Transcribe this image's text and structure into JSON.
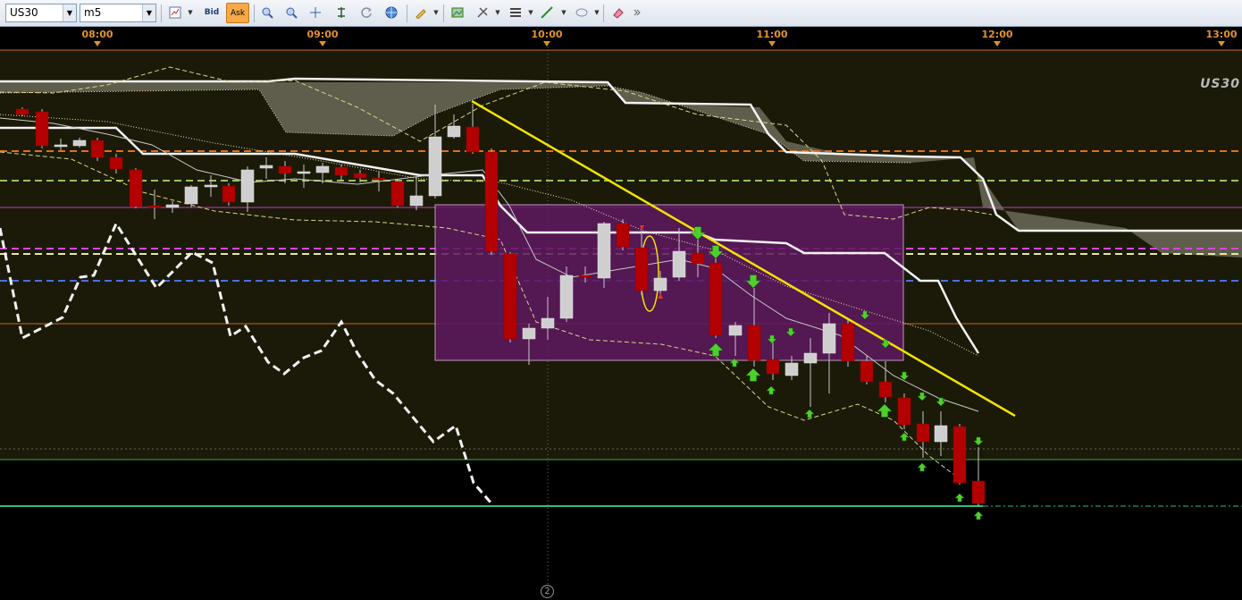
{
  "toolbar": {
    "symbol_value": "US30",
    "timeframe_value": "m5",
    "bid_label": "Bid",
    "ask_label": "Ask",
    "icons": [
      "chart-type-icon",
      "zoom-in-icon",
      "zoom-out-icon",
      "crosshair-icon",
      "period-separator-icon",
      "refresh-icon",
      "globe-icon",
      "pencil-icon",
      "picture-icon",
      "tools-icon",
      "lines-icon",
      "trendline-icon",
      "ellipse-icon",
      "eraser-icon",
      "more-icon"
    ]
  },
  "time_axis": {
    "labels": [
      "08:00",
      "09:00",
      "10:00",
      "11:00",
      "12:00",
      "13:00"
    ]
  },
  "chart": {
    "symbol_watermark": "US30",
    "page_indicator": "2",
    "colors": {
      "background": "#1b1a09",
      "bull_candle": "#cfcfcf",
      "bear_candle": "#b30000",
      "zone_fill": "#5e1860",
      "trendline": "#f0e400",
      "cloud": "#6b6a58",
      "arrow_green": "#4bd12a"
    }
  }
}
